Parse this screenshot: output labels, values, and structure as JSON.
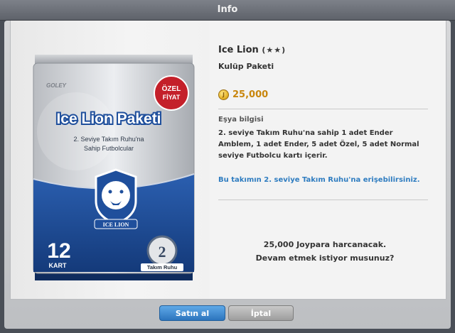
{
  "window": {
    "title": "Info"
  },
  "pack": {
    "brand": "GOLEY",
    "badge_line1": "ÖZEL",
    "badge_line2": "FİYAT",
    "name": "Ice Lion Paketi",
    "tagline_line1": "2. Seviye Takım Ruhu'na",
    "tagline_line2": "Sahip Futbolcular",
    "emblem_text": "ICE LION",
    "count": "12",
    "count_label": "KART",
    "spirit_level": "2",
    "spirit_label": "Takım Ruhu"
  },
  "item": {
    "name": "Ice Lion",
    "stars": "(★★)",
    "subtitle": "Kulüp Paketi",
    "price": "25,000",
    "section_title": "Eşya bilgisi",
    "description": "2. seviye Takım Ruhu'na sahip 1 adet Ender Amblem, 1 adet Ender, 5 adet Özel, 5 adet Normal seviye Futbolcu kartı içerir.",
    "note": "Bu takımın 2. seviye Takım Ruhu'na erişebilirsiniz.",
    "confirm_line1": "25,000 Joypara harcanacak.",
    "confirm_line2": "Devam etmek istiyor musunuz?"
  },
  "buttons": {
    "buy": "Satın al",
    "cancel": "İptal"
  },
  "colors": {
    "accent": "#2e7cc0",
    "price": "#c8860d",
    "pack_blue": "#1f4f9c"
  }
}
